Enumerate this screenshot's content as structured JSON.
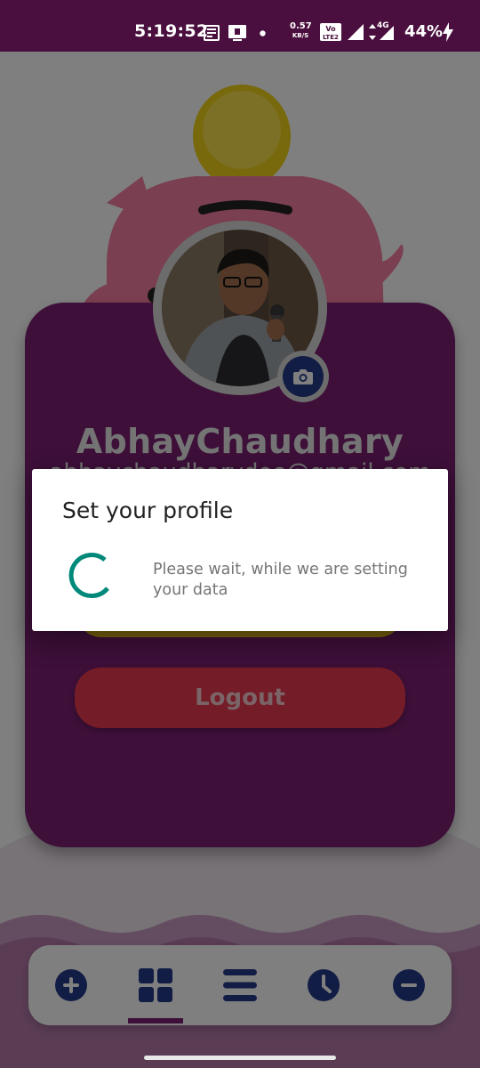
{
  "status_bar": {
    "time": "5:19:52",
    "net_speed_value": "0.57",
    "net_speed_unit": "KB/S",
    "network_type": "4G",
    "battery_percent": "44%"
  },
  "profile": {
    "name": "AbhayChaudhary",
    "email": "abhaychaudharydoe@gmail.com",
    "logout_label": "Logout"
  },
  "bottom_nav": {
    "items": [
      {
        "icon": "add-circle-icon",
        "selected": false
      },
      {
        "icon": "grid-icon",
        "selected": true
      },
      {
        "icon": "list-icon",
        "selected": false
      },
      {
        "icon": "clock-icon",
        "selected": false
      },
      {
        "icon": "minus-circle-icon",
        "selected": false
      }
    ]
  },
  "dialog": {
    "title": "Set your profile",
    "message": "Please wait, while we are setting your data"
  },
  "colors": {
    "status_bar": "#4a0f3e",
    "card": "#7b1f72",
    "logout": "#e8394e",
    "edit": "#f3c620",
    "nav_icon": "#243a8a",
    "spinner": "#00897b"
  }
}
